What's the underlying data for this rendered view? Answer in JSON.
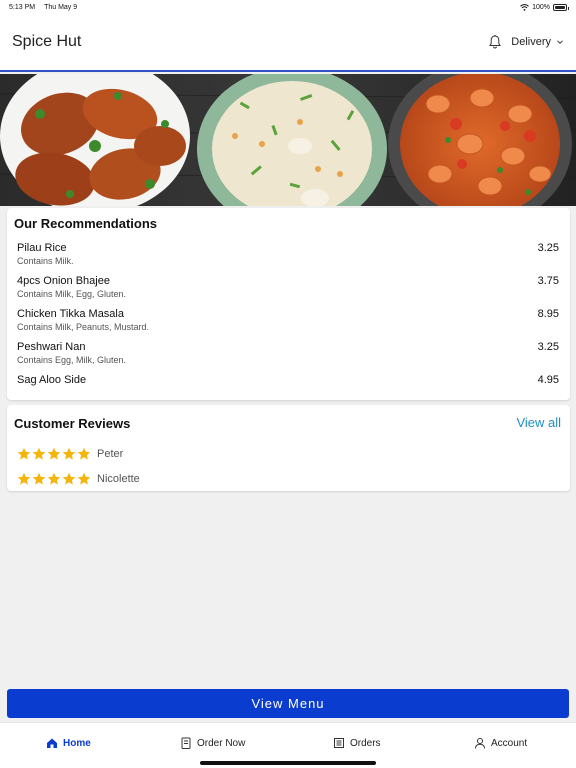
{
  "status_bar": {
    "time": "5:13 PM",
    "date": "Thu May 9",
    "battery": "100%",
    "battery_level": 1.0
  },
  "header": {
    "title": "Spice Hut",
    "delivery_label": "Delivery"
  },
  "hero": {
    "icons": [
      "roast-chicken",
      "fried-rice",
      "prawn-curry"
    ]
  },
  "recommendations": {
    "title": "Our Recommendations",
    "items": [
      {
        "name": "Pilau Rice",
        "allergens": "Contains Milk.",
        "price": "3.25"
      },
      {
        "name": "4pcs Onion Bhajee",
        "allergens": "Contains Milk, Egg, Gluten.",
        "price": "3.75"
      },
      {
        "name": "Chicken Tikka Masala",
        "allergens": "Contains Milk, Peanuts, Mustard.",
        "price": "8.95"
      },
      {
        "name": "Peshwari Nan",
        "allergens": "Contains Egg, Milk, Gluten.",
        "price": "3.25"
      },
      {
        "name": "Sag Aloo Side",
        "allergens": "",
        "price": "4.95"
      }
    ]
  },
  "reviews": {
    "title": "Customer Reviews",
    "view_all": "View all",
    "items": [
      {
        "name": "Peter",
        "rating": 5
      },
      {
        "name": "Nicolette",
        "rating": 5
      }
    ]
  },
  "view_menu_label": "View Menu",
  "nav": {
    "home": "Home",
    "order_now": "Order Now",
    "orders": "Orders",
    "account": "Account"
  },
  "colors": {
    "primary": "#0a3ccf",
    "star": "#f5b50c",
    "link": "#1f8fc0",
    "header_border": "#3550c4"
  }
}
